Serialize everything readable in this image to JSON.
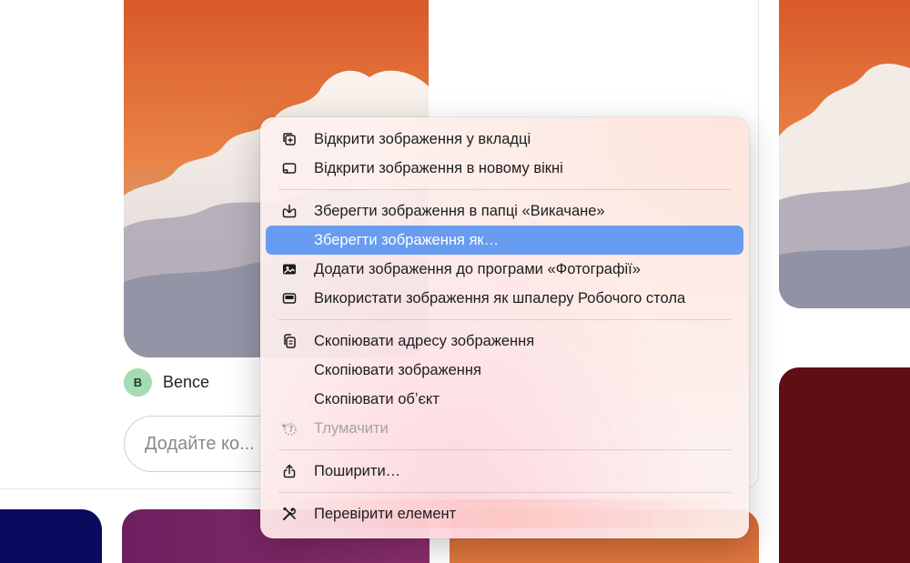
{
  "pin": {
    "author_initial": "B",
    "author_name": "Bence",
    "comment_placeholder": "Додайте ко..."
  },
  "context_menu": {
    "groups": [
      [
        {
          "label": "Відкрити зображення у вкладці",
          "icon": "open-in-tab-icon",
          "disabled": false,
          "highlighted": false
        },
        {
          "label": "Відкрити зображення в новому вікні",
          "icon": "open-in-window-icon",
          "disabled": false,
          "highlighted": false
        }
      ],
      [
        {
          "label": "Зберегти зображення в папці «Викачане»",
          "icon": "download-icon",
          "disabled": false,
          "highlighted": false
        },
        {
          "label": "Зберегти зображення як…",
          "icon": "",
          "disabled": false,
          "highlighted": true
        },
        {
          "label": "Додати зображення до програми «Фотографії»",
          "icon": "photos-icon",
          "disabled": false,
          "highlighted": false
        },
        {
          "label": "Використати зображення як шпалеру Робочого стола",
          "icon": "desktop-icon",
          "disabled": false,
          "highlighted": false
        }
      ],
      [
        {
          "label": "Скопіювати адресу зображення",
          "icon": "copy-icon",
          "disabled": false,
          "highlighted": false
        },
        {
          "label": "Скопіювати зображення",
          "icon": "",
          "disabled": false,
          "highlighted": false
        },
        {
          "label": "Скопіювати обʼєкт",
          "icon": "",
          "disabled": false,
          "highlighted": false
        },
        {
          "label": "Тлумачити",
          "icon": "translate-icon",
          "disabled": true,
          "highlighted": false
        }
      ],
      [
        {
          "label": "Поширити…",
          "icon": "share-icon",
          "disabled": false,
          "highlighted": false
        }
      ],
      [
        {
          "label": "Перевірити елемент",
          "icon": "inspect-tools-icon",
          "disabled": false,
          "highlighted": false
        }
      ]
    ]
  },
  "colors": {
    "highlight": "#679cf0",
    "avatar_bg": "#a6dcb3",
    "sky_orange": "#d9622a"
  }
}
